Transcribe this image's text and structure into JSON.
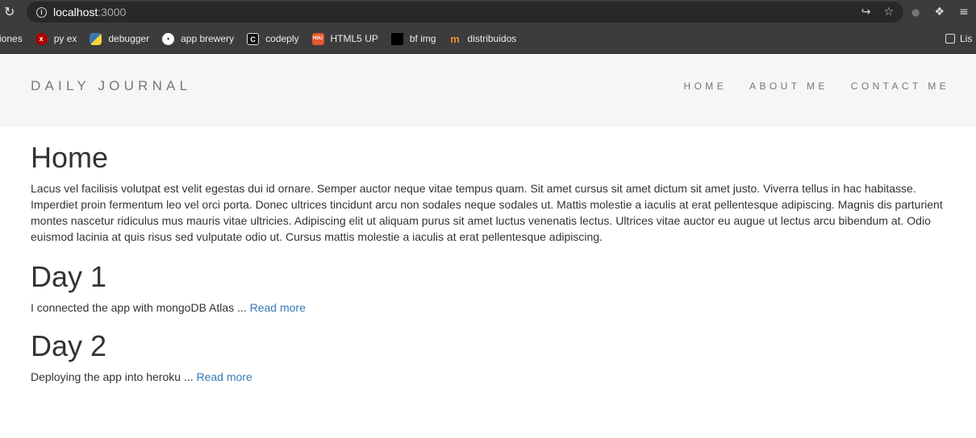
{
  "browser": {
    "url_host": "localhost",
    "url_port": ":3000",
    "bookmarks": [
      {
        "label": "iones",
        "icon": ""
      },
      {
        "label": "py ex",
        "icon": "red-circle-icon"
      },
      {
        "label": "debugger",
        "icon": "python-icon"
      },
      {
        "label": "app brewery",
        "icon": "app-brewery-icon"
      },
      {
        "label": "codeply",
        "icon": "codeply-icon"
      },
      {
        "label": "HTML5 UP",
        "icon": "html5up-icon"
      },
      {
        "label": "bf img",
        "icon": "bf-img-icon"
      },
      {
        "label": "distribuidos",
        "icon": "distribuidos-icon"
      }
    ],
    "reading_list_label": "Lis",
    "colors": {
      "chrome_bg": "#3c3c3c",
      "omnibox_bg": "#282828"
    }
  },
  "site": {
    "brand": "DAILY JOURNAL",
    "nav": {
      "home": "HOME",
      "about": "ABOUT ME",
      "contact": "CONTACT ME"
    },
    "colors": {
      "navbar_bg": "#f6f6f6",
      "link": "#337ab7",
      "nav_text": "#777777"
    }
  },
  "main": {
    "title": "Home",
    "intro": "Lacus vel facilisis volutpat est velit egestas dui id ornare. Semper auctor neque vitae tempus quam. Sit amet cursus sit amet dictum sit amet justo. Viverra tellus in hac habitasse. Imperdiet proin fermentum leo vel orci porta. Donec ultrices tincidunt arcu non sodales neque sodales ut. Mattis molestie a iaculis at erat pellentesque adipiscing. Magnis dis parturient montes nascetur ridiculus mus mauris vitae ultricies. Adipiscing elit ut aliquam purus sit amet luctus venenatis lectus. Ultrices vitae auctor eu augue ut lectus arcu bibendum at. Odio euismod lacinia at quis risus sed vulputate odio ut. Cursus mattis molestie a iaculis at erat pellentesque adipiscing.",
    "posts": [
      {
        "title": "Day 1",
        "excerpt": "I connected the app with mongoDB Atlas ... ",
        "read_more": "Read more"
      },
      {
        "title": "Day 2",
        "excerpt": "Deploying the app into heroku ... ",
        "read_more": "Read more"
      }
    ]
  }
}
